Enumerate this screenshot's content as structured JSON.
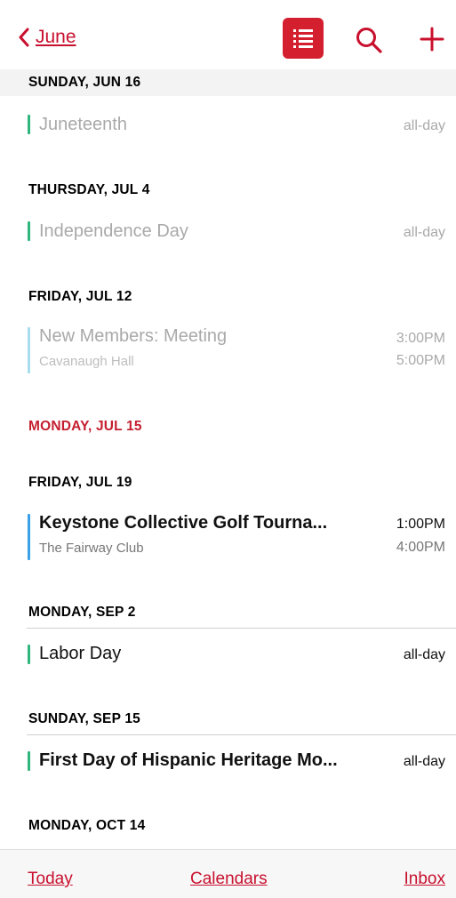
{
  "nav": {
    "back_label": "June"
  },
  "sections": [
    {
      "date": "SUNDAY, JUN 16"
    },
    {
      "date": "THURSDAY, JUL 4"
    },
    {
      "date": "FRIDAY, JUL 12"
    },
    {
      "date": "MONDAY, JUL 15"
    },
    {
      "date": "FRIDAY, JUL 19"
    },
    {
      "date": "MONDAY, SEP 2"
    },
    {
      "date": "SUNDAY, SEP 15"
    },
    {
      "date": "MONDAY, OCT 14"
    }
  ],
  "events": [
    {
      "title": "Juneteenth",
      "time": "all-day",
      "bar_color": "#2eb67d"
    },
    {
      "title": "Independence Day",
      "time": "all-day",
      "bar_color": "#2eb67d"
    },
    {
      "title": "New Members: Meeting",
      "location": "Cavanaugh Hall",
      "start": "3:00PM",
      "end": "5:00PM",
      "bar_color": "#a8dcef"
    },
    {
      "title": "Keystone Collective Golf Tourna...",
      "location": "The Fairway Club",
      "start": "1:00PM",
      "end": "4:00PM",
      "bar_color": "#3aa0e8"
    },
    {
      "title": "Labor Day",
      "time": "all-day",
      "bar_color": "#2eb67d"
    },
    {
      "title": "First Day of Hispanic Heritage Mo...",
      "time": "all-day",
      "bar_color": "#2eb67d"
    }
  ],
  "tabbar": {
    "today": "Today",
    "calendars": "Calendars",
    "inbox": "Inbox"
  },
  "colors": {
    "accent": "#c8102e",
    "today_header": "#c41e2f",
    "holiday_bar": "#2eb67d",
    "faded_bar": "#a8dcef",
    "event_bar": "#3aa0e8"
  }
}
